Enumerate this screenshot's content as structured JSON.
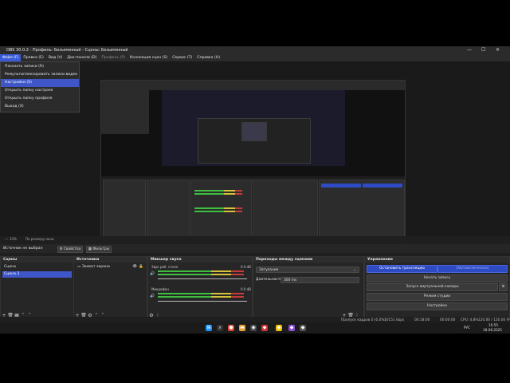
{
  "window": {
    "title": "OBS 30.0.2 - Профиль: Безымянный - Сцены: Безымянный",
    "controls": [
      "—",
      "☐",
      "✕"
    ]
  },
  "menu": [
    {
      "label": "Файл (F)",
      "active": true
    },
    {
      "label": "Правка (E)"
    },
    {
      "label": "Вид (V)"
    },
    {
      "label": "Док-панели (D)"
    },
    {
      "label": "Профиль (P)",
      "dim": true
    },
    {
      "label": "Коллекция сцен (S)"
    },
    {
      "label": "Сервис (T)"
    },
    {
      "label": "Справка (H)"
    }
  ],
  "file_menu": [
    {
      "label": "Показать записи (R)"
    },
    {
      "label": "Ремультиплексировать записи видео (M)"
    },
    {
      "label": "Настройки (S)",
      "highlighted": true
    },
    {
      "label": "Открыть папку настроек"
    },
    {
      "label": "Открыть папку профиля"
    },
    {
      "label": "Выход (X)"
    }
  ],
  "preview": {
    "zoom_label": "33%",
    "zoom_mode": "По размеру окна"
  },
  "source_bar": {
    "no_source": "Источник не выбран",
    "properties": "Свойства",
    "filters": "Фильтры"
  },
  "scenes": {
    "title": "Сцены",
    "items": [
      {
        "label": "Сцена"
      },
      {
        "label": "Сцена 2",
        "selected": true
      }
    ]
  },
  "sources": {
    "title": "Источники",
    "items": [
      {
        "label": "Захват экрана"
      }
    ]
  },
  "mixer": {
    "title": "Микшер звука",
    "channels": [
      {
        "name": "Звук раб. стола",
        "db": "0.0 dB"
      },
      {
        "name": "Микрофон",
        "db": "0.0 dB"
      }
    ]
  },
  "transitions": {
    "title": "Переходы между сценами",
    "type": "Затухание",
    "duration_label": "Длительность",
    "duration_value": "300 ms"
  },
  "controls": {
    "title": "Управление",
    "buttons": [
      {
        "label": "Остановить трансляцию",
        "primary": true
      },
      {
        "label": "(Автоматическое)"
      },
      {
        "label": "Начать запись"
      },
      {
        "label": "Запуск виртуальной камеры"
      },
      {
        "label": "Режим студии"
      },
      {
        "label": "Настройки"
      }
    ]
  },
  "status": {
    "dropped": "Пропуск кадров 0 (0,0%)",
    "bitrate": "10151 kbps",
    "stream_time": "00:18:00",
    "rec_time": "00:00:00",
    "cpu": "CPU: 4,8%",
    "fps": "120.00 / 120.00 FPS"
  },
  "taskbar": {
    "lang": "РУС",
    "time": "16:55",
    "date": "18.08.2025"
  },
  "colors": {
    "accent": "#3f56c8",
    "bg": "#1f1f1f",
    "panel": "#262626"
  }
}
